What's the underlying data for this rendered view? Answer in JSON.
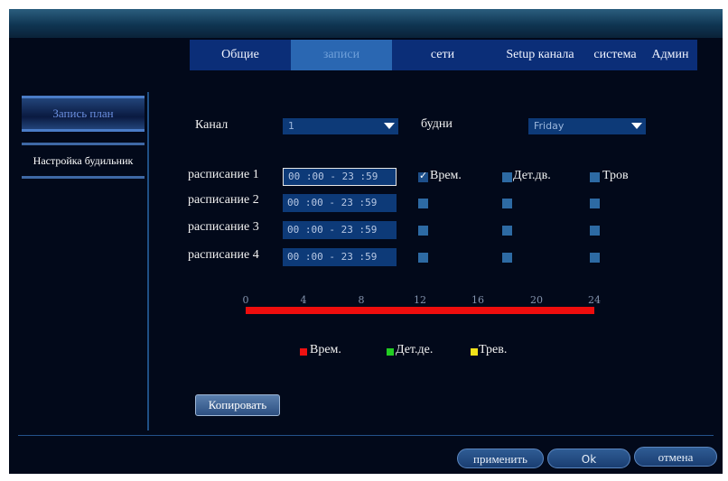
{
  "tabs": [
    {
      "label": "Общие",
      "active": false
    },
    {
      "label": "записи",
      "active": true
    },
    {
      "label": "сети",
      "active": false
    },
    {
      "label": "Setup канала",
      "active": false
    },
    {
      "label": "система",
      "active": false
    },
    {
      "label": "Админ",
      "active": false
    }
  ],
  "sidebar": {
    "items": [
      {
        "label": "Запись план",
        "active": true
      },
      {
        "label": "Настройка будильник",
        "active": false
      }
    ]
  },
  "form": {
    "channel_label": "Канал",
    "channel_value": "1",
    "weekday_label": "будни",
    "weekday_value": "Friday"
  },
  "schedules": [
    {
      "label": "расписание 1",
      "time": "00 :00 - 23 :59",
      "normal": true,
      "motion": false,
      "alarm": false
    },
    {
      "label": "расписание 2",
      "time": "00 :00 - 23 :59",
      "normal": false,
      "motion": false,
      "alarm": false
    },
    {
      "label": "расписание 3",
      "time": "00 :00 - 23 :59",
      "normal": false,
      "motion": false,
      "alarm": false
    },
    {
      "label": "расписание 4",
      "time": "00 :00 - 23 :59",
      "normal": false,
      "motion": false,
      "alarm": false
    }
  ],
  "columns": {
    "normal": "Врем.",
    "motion": "Дет.дв.",
    "alarm": "Тров"
  },
  "timeline": {
    "ticks": [
      "0",
      "4",
      "8",
      "12",
      "16",
      "20",
      "24"
    ],
    "bar_color": "#ee0d0d",
    "coverage": [
      0,
      24
    ]
  },
  "legend": [
    {
      "label": "Врем.",
      "color": "#ee1111"
    },
    {
      "label": "Дет.де.",
      "color": "#22cc22"
    },
    {
      "label": "Трев.",
      "color": "#f2e21a"
    }
  ],
  "buttons": {
    "copy": "Копировать",
    "apply": "применить",
    "ok": "Ok",
    "cancel": "отмена"
  }
}
